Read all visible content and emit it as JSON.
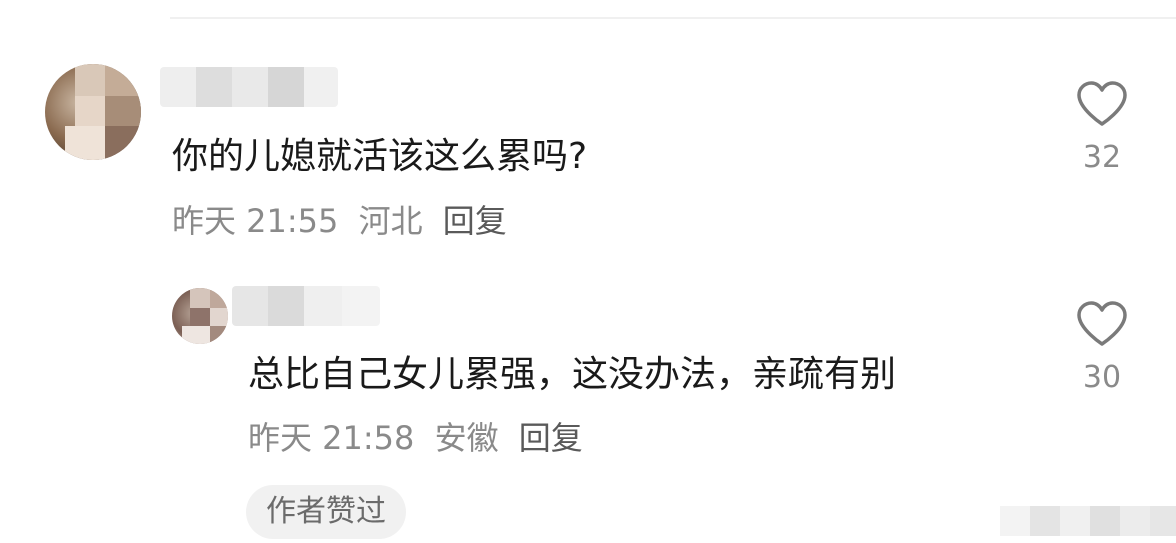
{
  "comment": {
    "text": "你的儿媳就活该这么累吗?",
    "time": "昨天 21:55",
    "location": "河北",
    "reply_label": "回复",
    "likes": "32"
  },
  "reply": {
    "text": "总比自己女儿累强，这没办法，亲疏有别",
    "time": "昨天 21:58",
    "location": "安徽",
    "reply_label": "回复",
    "likes": "30",
    "author_liked_label": "作者赞过"
  },
  "colors": {
    "text": "#1a1a1a",
    "meta": "#8a8a8a",
    "icon": "#7a7a7a",
    "chip_bg": "#f1f1f1"
  },
  "icons": [
    "heart-outline-icon"
  ]
}
